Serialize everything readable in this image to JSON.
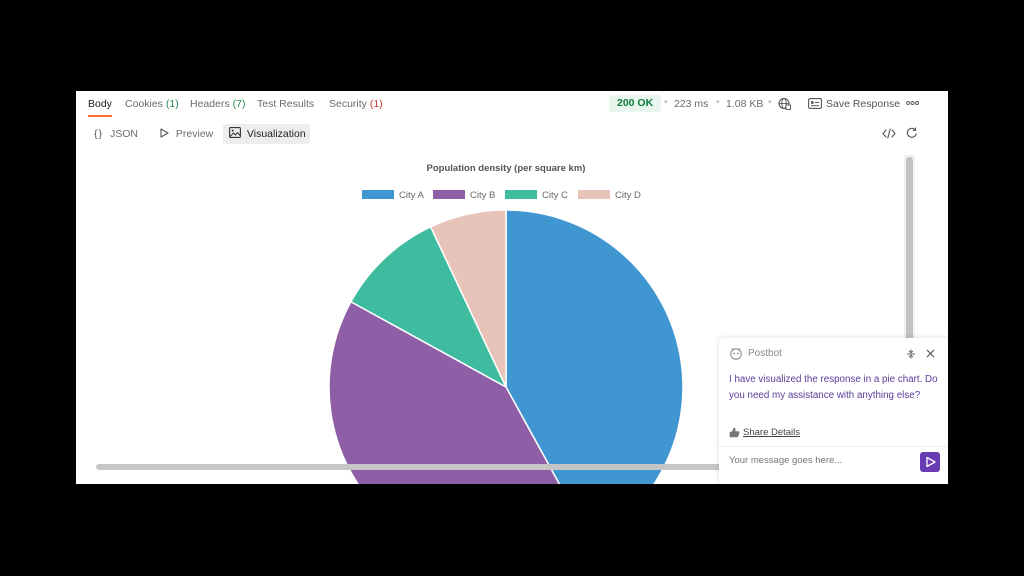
{
  "tabs": [
    {
      "label": "Body",
      "count": ""
    },
    {
      "label": "Cookies",
      "count": "(1)"
    },
    {
      "label": "Headers",
      "count": "(7)"
    },
    {
      "label": "Test Results",
      "count": ""
    },
    {
      "label": "Security",
      "count": "(1)"
    }
  ],
  "response": {
    "status": "200 OK",
    "time": "223 ms",
    "size": "1.08 KB",
    "save_label": "Save Response"
  },
  "view_modes": {
    "json": "JSON",
    "preview": "Preview",
    "visualization": "Visualization",
    "selected": "Visualization"
  },
  "chart_data": {
    "type": "pie",
    "title": "Population density (per square km)",
    "categories": [
      "City A",
      "City B",
      "City C",
      "City D"
    ],
    "values": [
      42,
      41,
      10,
      7
    ],
    "colors": [
      "#4096d0",
      "#8e5ea6",
      "#3fbca0",
      "#e8c3b9"
    ],
    "legend_position": "top"
  },
  "postbot": {
    "title": "Postbot",
    "message": "I have visualized the response in a pie chart. Do you need my assistance with anything else?",
    "share_label": "Share Details",
    "input_placeholder": "Your message goes here..."
  }
}
